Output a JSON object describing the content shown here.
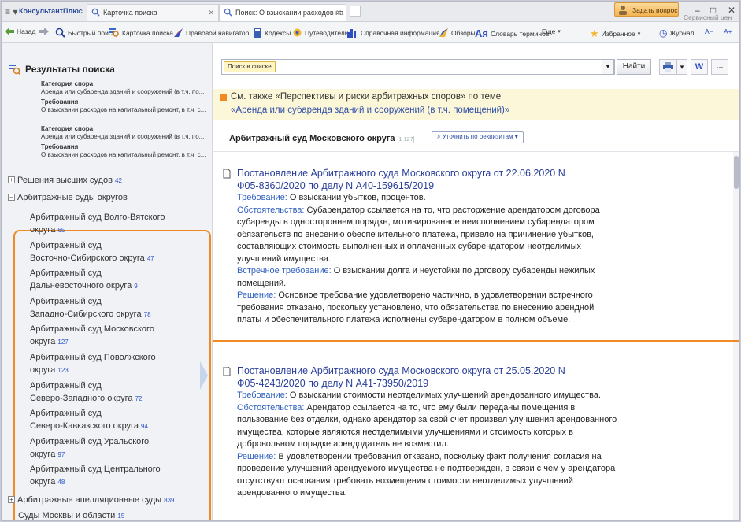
{
  "tabbar": {
    "brand": "КонсультантПлюс",
    "tabs": [
      {
        "label": "Карточка поиска"
      },
      {
        "label": "Поиск: О взыскании расходов на ка"
      }
    ],
    "ask_button": "Задать вопрос",
    "service_link": "Сервисный цен",
    "window_controls": [
      "–",
      "□",
      "✕"
    ]
  },
  "toolbar": {
    "back": "Назад",
    "quick_search": "Быстрый поиск",
    "search_card": "Карточка поиска",
    "legal_navigator": "Правовой навигатор",
    "codes": "Кодексы",
    "guides": "Путеводители",
    "reference": "Справочная информация",
    "reviews": "Обзоры",
    "glossary": "Словарь терминов",
    "more": "Еще",
    "favorites": "Избранное",
    "journal": "Журнал",
    "font_small": "A−",
    "font_large": "A+"
  },
  "left": {
    "title": "Результаты поиска",
    "criteria": [
      {
        "label": "Категория спора",
        "value": "Аренда или субаренда зданий и сооружений (в т.ч. по..."
      },
      {
        "label": "Требования",
        "value": "О взыскании расходов на капитальный ремонт, в т.ч. с..."
      },
      {
        "label": "Категория спора",
        "value": "Аренда или субаренда зданий и сооружений (в т.ч. по..."
      },
      {
        "label": "Требования",
        "value": "О взыскании расходов на капитальный ремонт, в т.ч. с..."
      }
    ],
    "higher_courts": {
      "label": "Решения высших судов",
      "count": "42"
    },
    "district_courts": {
      "label": "Арбитражные суды округов"
    },
    "courts": [
      {
        "line1": "Арбитражный суд Волго-Вятского",
        "line2": "округа",
        "count": "65"
      },
      {
        "line1": "Арбитражный суд",
        "line2": "Восточно-Сибирского округа",
        "count": "47"
      },
      {
        "line1": "Арбитражный суд",
        "line2": "Дальневосточного округа",
        "count": "9"
      },
      {
        "line1": "Арбитражный суд",
        "line2": "Западно-Сибирского округа",
        "count": "78"
      },
      {
        "line1": "Арбитражный суд Московского",
        "line2": "округа",
        "count": "127"
      },
      {
        "line1": "Арбитражный суд Поволжского",
        "line2": "округа",
        "count": "123"
      },
      {
        "line1": "Арбитражный суд",
        "line2": "Северо-Западного округа",
        "count": "72"
      },
      {
        "line1": "Арбитражный суд",
        "line2": "Северо-Кавказского округа",
        "count": "94"
      },
      {
        "line1": "Арбитражный суд Уральского",
        "line2": "округа",
        "count": "97"
      },
      {
        "line1": "Арбитражный суд Центрального",
        "line2": "округа",
        "count": "48"
      }
    ],
    "appeal_courts": {
      "label": "Арбитражные апелляционные суды",
      "count": "839"
    },
    "moscow_courts": {
      "label": "Суды Москвы и области",
      "count": "15"
    }
  },
  "main": {
    "search_pill": "Поиск в списке",
    "find_button": "Найти",
    "banner_line1": "См. также «Перспективы и риски арбитражных споров» по теме",
    "banner_line2": "«Аренда или субаренда зданий и сооружений (в т.ч. помещений)»",
    "court_header": "Арбитражный суд Московского округа",
    "court_header_count": "[1-127]",
    "refine_button": "Уточнить по реквизитам",
    "documents": [
      {
        "title1": "Постановление Арбитражного суда Московского округа от 22.06.2020 N",
        "title2": "Ф05-8360/2020 по делу N А40-159615/2019",
        "lines": [
          {
            "label": "Требование:",
            "text": " О взыскании убытков, процентов."
          },
          {
            "label": "Обстоятельства:",
            "text": " Субарендатор ссылается на то, что расторжение арендатором договора"
          },
          {
            "label": "",
            "text": "субаренды в одностороннем порядке, мотивированное неисполнением субарендатором"
          },
          {
            "label": "",
            "text": "обязательств по внесению обеспечительного платежа, привело на причинение убытков,"
          },
          {
            "label": "",
            "text": "составляющих стоимость выполненных и оплаченных субарендатором неотделимых"
          },
          {
            "label": "",
            "text": "улучшений имущества."
          },
          {
            "label": "Встречное требование:",
            "text": " О взыскании долга и неустойки по договору субаренды нежилых"
          },
          {
            "label": "",
            "text": "помещений."
          },
          {
            "label": "Решение:",
            "text": " Основное требование удовлетворено частично, в удовлетворении встречного"
          },
          {
            "label": "",
            "text": "требования отказано, поскольку установлено, что обязательства по внесению арендной"
          },
          {
            "label": "",
            "text": "платы и обеспечительного платежа исполнены субарендатором в полном объеме."
          }
        ]
      },
      {
        "title1": "Постановление Арбитражного суда Московского округа от 25.05.2020 N",
        "title2": "Ф05-4243/2020 по делу N А41-73950/2019",
        "lines": [
          {
            "label": "Требование:",
            "text": " О взыскании стоимости неотделимых улучшений арендованного имущества."
          },
          {
            "label": "Обстоятельства:",
            "text": " Арендатор ссылается на то, что ему были переданы помещения в"
          },
          {
            "label": "",
            "text": "пользование без отделки, однако арендатор за свой счет произвел улучшения арендованного"
          },
          {
            "label": "",
            "text": "имущества, которые являются неотделимыми улучшениями и стоимость которых в"
          },
          {
            "label": "",
            "text": "добровольном порядке арендодатель не возместил."
          },
          {
            "label": "Решение:",
            "text": " В удовлетворении требования отказано, поскольку факт получения согласия на"
          },
          {
            "label": "",
            "text": "проведение улучшений арендуемого имущества не подтвержден, в связи с чем у арендатора"
          },
          {
            "label": "",
            "text": "отсутствуют основания требовать возмещения стоимости неотделимых улучшений"
          },
          {
            "label": "",
            "text": "арендованного имущества."
          }
        ]
      }
    ]
  },
  "colors": {
    "accent_orange": "#f08a24",
    "link_blue": "#2a3f9a",
    "label_blue": "#2f5fc0",
    "selection": "#c6d4ec"
  }
}
